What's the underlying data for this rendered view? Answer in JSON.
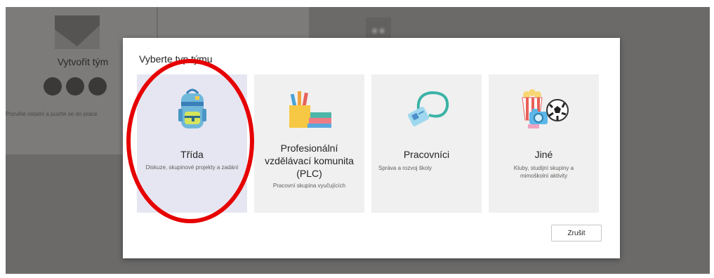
{
  "background": {
    "create_team_title": "Vytvořit tým",
    "create_team_subtitle": "Pozvěte ostatní a pusťte se do práce"
  },
  "dialog": {
    "title": "Vyberte typ týmu",
    "cards": [
      {
        "title": "Třída",
        "description": "Diskuze, skupinové projekty a zadání",
        "icon": "backpack-icon"
      },
      {
        "title": "Profesionální vzdělávací komunita (PLC)",
        "description": "Pracovní skupina vyučujících",
        "icon": "books-pencils-icon"
      },
      {
        "title": "Pracovníci",
        "description": "Správa a rozvoj školy",
        "icon": "lanyard-badge-icon"
      },
      {
        "title": "Jiné",
        "description": "Kluby, studijní skupiny a mimoškolní aktivity",
        "icon": "popcorn-camera-ball-icon"
      }
    ],
    "cancel_label": "Zrušit"
  },
  "colors": {
    "selected_card": "#e6e6f2",
    "card": "#f0f0f0",
    "overlay": "#6b6a69",
    "annotation": "#e60000"
  }
}
